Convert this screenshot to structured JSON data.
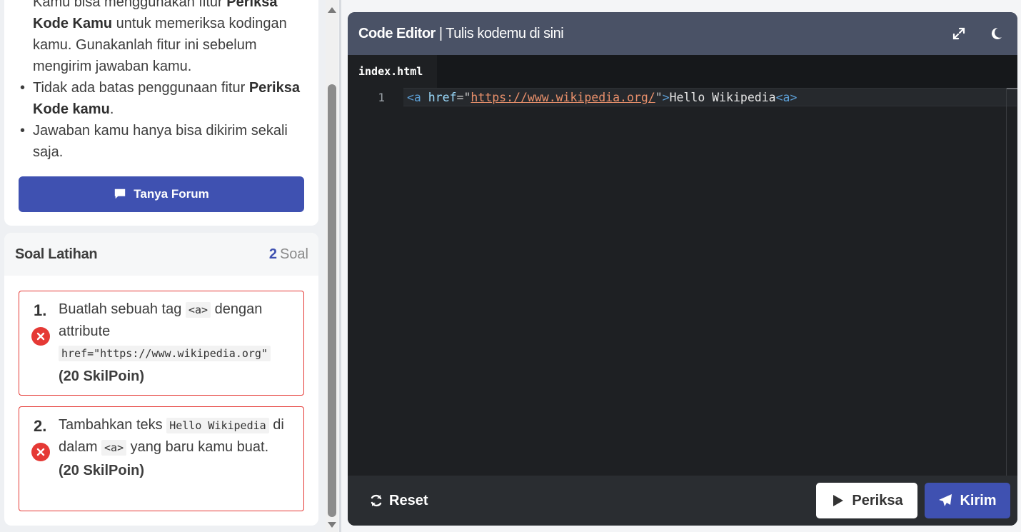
{
  "guide": {
    "line0_pre": "Kamu bisa menggunakan fitur ",
    "line0_bold": "Periksa Kode Kamu",
    "line0_post": " untuk memeriksa kodingan kamu. Gunakanlah fitur ini sebelum mengirim jawaban kamu.",
    "item1_pre": "Tidak ada batas penggunaan fitur ",
    "item1_bold": "Periksa Kode kamu",
    "item1_post": ".",
    "item2": "Jawaban kamu hanya bisa dikirim sekali saja."
  },
  "forum_button": "Tanya Forum",
  "soal": {
    "title": "Soal Latihan",
    "count": "2",
    "count_label": "Soal",
    "items": [
      {
        "num": "1.",
        "text_a": "Buatlah sebuah tag ",
        "code_a": "<a>",
        "text_b": " dengan attribute ",
        "code_b": "href=\"https://www.wikipedia.org\"",
        "points": "(20 SkilPoin)"
      },
      {
        "num": "2.",
        "text_a": "Tambahkan teks ",
        "code_a": "Hello Wikipedia",
        "text_b": " di dalam ",
        "code_b": "<a>",
        "text_c": " yang baru kamu buat.",
        "points": "(20 SkilPoin)"
      }
    ]
  },
  "editor": {
    "title_bold": "Code Editor",
    "title_rest": " | Tulis kodemu di sini",
    "tab": "index.html",
    "line_number": "1",
    "code": {
      "open": "<a",
      "attr": " href",
      "eq": "=\"",
      "url": "https://www.wikipedia.org/",
      "close_q": "\"",
      "gt": ">",
      "text": "Hello Wikipedia",
      "end": "<a>"
    },
    "reset": "Reset",
    "periksa": "Periksa",
    "kirim": "Kirim"
  },
  "colors": {
    "primary": "#3f51b1",
    "error": "#e53935",
    "editor_header": "#4a5266",
    "editor_bg": "#1e2023"
  }
}
